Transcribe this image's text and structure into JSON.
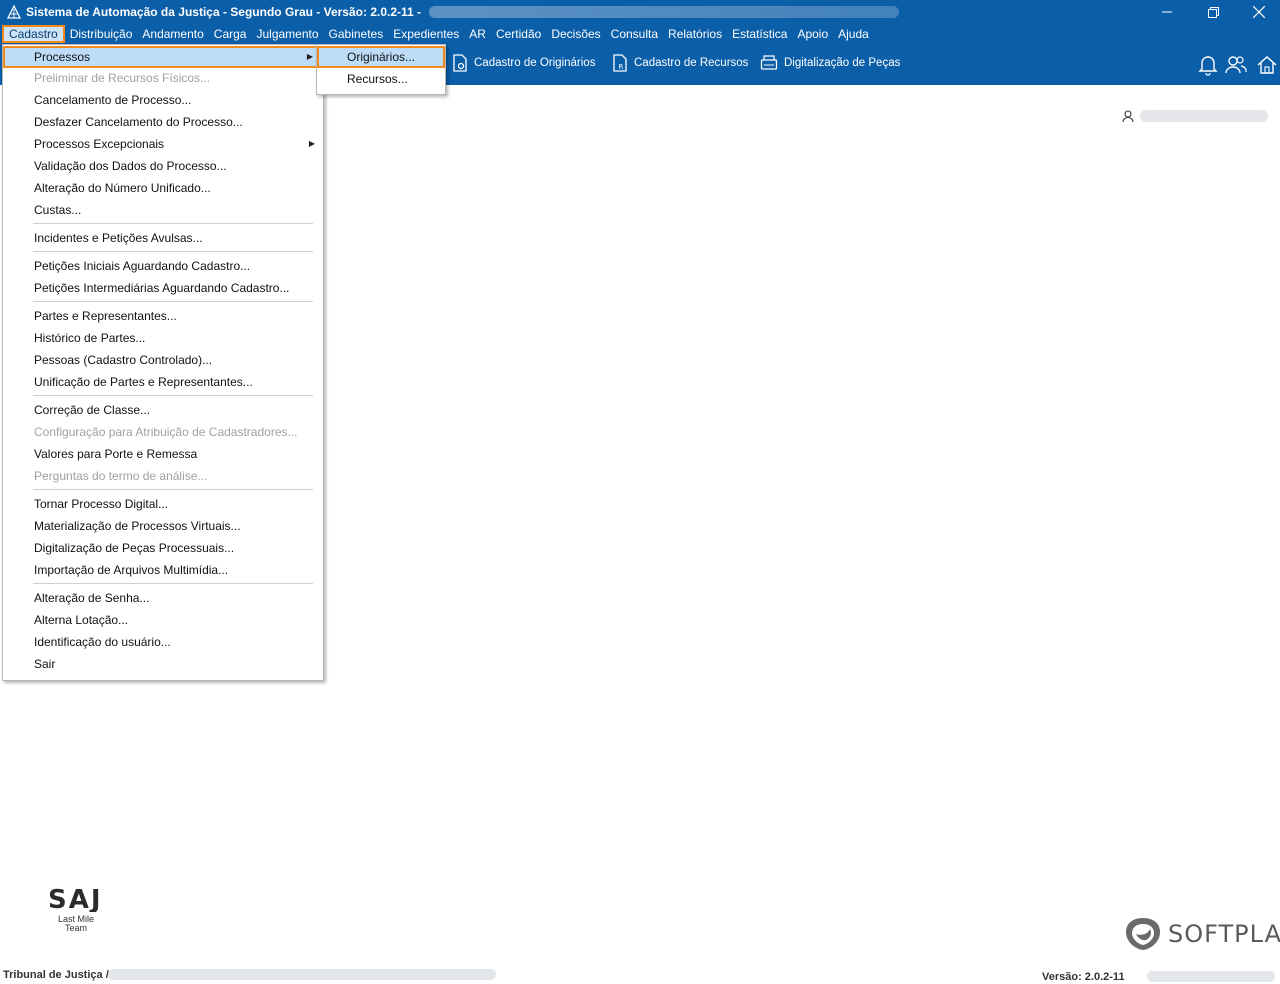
{
  "window": {
    "title": "Sistema de Automação da Justiça - Segundo Grau - Versão: 2.0.2-11 -"
  },
  "menubar": {
    "items": [
      "Cadastro",
      "Distribuição",
      "Andamento",
      "Carga",
      "Julgamento",
      "Gabinetes",
      "Expedientes",
      "AR",
      "Certidão",
      "Decisões",
      "Consulta",
      "Relatórios",
      "Estatística",
      "Apoio",
      "Ajuda"
    ],
    "active": "Cadastro"
  },
  "toolbar": {
    "buttons": [
      "Cadastro de Originários",
      "Cadastro de Recursos",
      "Digitalização de Peças"
    ]
  },
  "dropdown": {
    "items": [
      {
        "label": "Processos",
        "state": "highlighted",
        "submenu": true
      },
      {
        "label": "Preliminar de Recursos Físicos...",
        "state": "disabled"
      },
      {
        "label": "Cancelamento de Processo...",
        "state": "enabled"
      },
      {
        "label": "Desfazer Cancelamento do Processo...",
        "state": "enabled"
      },
      {
        "label": "Processos Excepcionais",
        "state": "enabled",
        "submenu": true
      },
      {
        "label": "Validação dos Dados do Processo...",
        "state": "enabled"
      },
      {
        "label": "Alteração do Número Unificado...",
        "state": "enabled"
      },
      {
        "label": "Custas...",
        "state": "enabled"
      },
      {
        "label": "Incidentes e Petições Avulsas...",
        "state": "enabled"
      },
      {
        "label": "Petições Iniciais Aguardando Cadastro...",
        "state": "enabled"
      },
      {
        "label": "Petições Intermediárias Aguardando Cadastro...",
        "state": "enabled"
      },
      {
        "label": "Partes e Representantes...",
        "state": "enabled"
      },
      {
        "label": "Histórico de Partes...",
        "state": "enabled"
      },
      {
        "label": "Pessoas (Cadastro Controlado)...",
        "state": "enabled"
      },
      {
        "label": "Unificação de Partes e Representantes...",
        "state": "enabled"
      },
      {
        "label": "Correção de Classe...",
        "state": "enabled"
      },
      {
        "label": "Configuração para Atribuição de Cadastradores...",
        "state": "disabled"
      },
      {
        "label": "Valores para Porte e Remessa",
        "state": "enabled"
      },
      {
        "label": "Perguntas do termo de análise...",
        "state": "disabled"
      },
      {
        "label": "Tornar Processo Digital...",
        "state": "enabled"
      },
      {
        "label": "Materialização de Processos Virtuais...",
        "state": "enabled"
      },
      {
        "label": "Digitalização de Peças Processuais...",
        "state": "enabled"
      },
      {
        "label": "Importação de Arquivos Multimídia...",
        "state": "enabled"
      },
      {
        "label": "Alteração de Senha...",
        "state": "enabled"
      },
      {
        "label": "Alterna Lotação...",
        "state": "enabled"
      },
      {
        "label": "Identificação do usuário...",
        "state": "enabled"
      },
      {
        "label": "Sair",
        "state": "enabled"
      }
    ]
  },
  "submenu": {
    "items": [
      {
        "label": "Originários...",
        "state": "highlighted"
      },
      {
        "label": "Recursos...",
        "state": "enabled"
      }
    ]
  },
  "branding": {
    "saj": "SAJ",
    "saj_sub1": "Last Mile",
    "saj_sub2": "Team",
    "softplan": "SOFTPLAN"
  },
  "statusbar": {
    "left": "Tribunal de Justiça /",
    "version": "Versão: 2.0.2-11"
  },
  "colors": {
    "primary": "#0b5ea8",
    "highlight": "#bcdcf7",
    "focus_outline": "#f08a1c",
    "disabled_text": "#a0a0a0"
  }
}
